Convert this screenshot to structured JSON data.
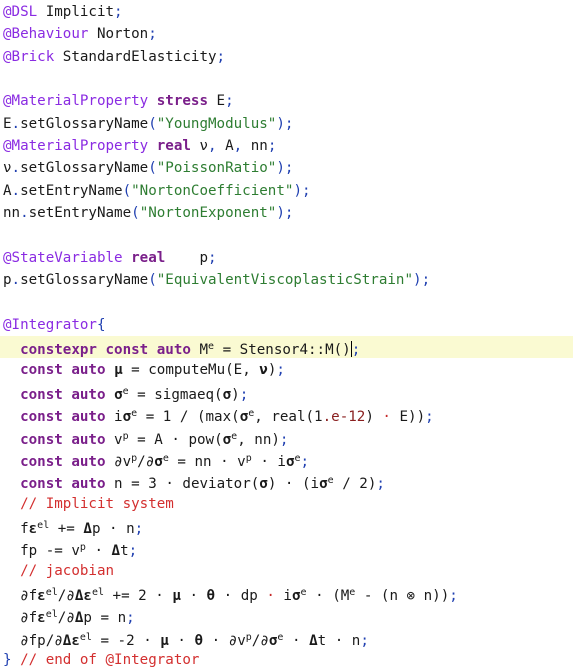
{
  "editor": {
    "highlight_color": "#fafad2",
    "current_line": 15,
    "lines": [
      [
        [
          "t-preproc",
          "@DSL"
        ],
        [
          "t-id",
          " Implicit"
        ],
        [
          "t-blue",
          ";"
        ]
      ],
      [
        [
          "t-preproc",
          "@Behaviour"
        ],
        [
          "t-id",
          " Norton"
        ],
        [
          "t-blue",
          ";"
        ]
      ],
      [
        [
          "t-preproc",
          "@Brick"
        ],
        [
          "t-id",
          " StandardElasticity"
        ],
        [
          "t-blue",
          ";"
        ]
      ],
      [],
      [
        [
          "t-preproc",
          "@MaterialProperty "
        ],
        [
          "t-kw",
          "stress"
        ],
        [
          "t-id",
          " E"
        ],
        [
          "t-blue",
          ";"
        ]
      ],
      [
        [
          "t-id",
          "E"
        ],
        [
          "t-blue",
          "."
        ],
        [
          "t-id",
          "setGlossaryName"
        ],
        [
          "t-blue",
          "("
        ],
        [
          "t-str",
          "\"YoungModulus\""
        ],
        [
          "t-blue",
          ")"
        ],
        [
          "t-blue",
          ";"
        ]
      ],
      [
        [
          "t-preproc",
          "@MaterialProperty "
        ],
        [
          "t-kw",
          "real"
        ],
        [
          "t-id",
          " ν"
        ],
        [
          "t-blue",
          ","
        ],
        [
          "t-id",
          " A"
        ],
        [
          "t-blue",
          ","
        ],
        [
          "t-id",
          " nn"
        ],
        [
          "t-blue",
          ";"
        ]
      ],
      [
        [
          "t-id",
          "ν"
        ],
        [
          "t-blue",
          "."
        ],
        [
          "t-id",
          "setGlossaryName"
        ],
        [
          "t-blue",
          "("
        ],
        [
          "t-str",
          "\"PoissonRatio\""
        ],
        [
          "t-blue",
          ")"
        ],
        [
          "t-blue",
          ";"
        ]
      ],
      [
        [
          "t-id",
          "A"
        ],
        [
          "t-blue",
          "."
        ],
        [
          "t-id",
          "setEntryName"
        ],
        [
          "t-blue",
          "("
        ],
        [
          "t-str",
          "\"NortonCoefficient\""
        ],
        [
          "t-blue",
          ")"
        ],
        [
          "t-blue",
          ";"
        ]
      ],
      [
        [
          "t-id",
          "nn"
        ],
        [
          "t-blue",
          "."
        ],
        [
          "t-id",
          "setEntryName"
        ],
        [
          "t-blue",
          "("
        ],
        [
          "t-str",
          "\"NortonExponent\""
        ],
        [
          "t-blue",
          ")"
        ],
        [
          "t-blue",
          ";"
        ]
      ],
      [],
      [
        [
          "t-preproc",
          "@StateVariable "
        ],
        [
          "t-kw",
          "real"
        ],
        [
          "t-id",
          "    p"
        ],
        [
          "t-blue",
          ";"
        ]
      ],
      [
        [
          "t-id",
          "p"
        ],
        [
          "t-blue",
          "."
        ],
        [
          "t-id",
          "setGlossaryName"
        ],
        [
          "t-blue",
          "("
        ],
        [
          "t-str",
          "\"EquivalentViscoplasticStrain\""
        ],
        [
          "t-blue",
          ")"
        ],
        [
          "t-blue",
          ";"
        ]
      ],
      [],
      [
        [
          "t-preproc",
          "@Integrator"
        ],
        [
          "t-blue",
          "{"
        ]
      ],
      [
        [
          "t-id",
          "  "
        ],
        [
          "t-kw",
          "constexpr const auto"
        ],
        [
          "t-id",
          " M"
        ],
        [
          "t-sup",
          "e"
        ],
        [
          "t-id",
          " = Stensor4::M()"
        ],
        [
          "caret",
          ""
        ],
        [
          "t-blue",
          ";"
        ]
      ],
      [
        [
          "t-id",
          "  "
        ],
        [
          "t-kw",
          "const auto"
        ],
        [
          "t-id",
          " "
        ],
        [
          "t-bold",
          "μ"
        ],
        [
          "t-id",
          " = computeMu(E, "
        ],
        [
          "t-bold",
          "ν"
        ],
        [
          "t-id",
          ")"
        ],
        [
          "t-blue",
          ";"
        ]
      ],
      [
        [
          "t-id",
          "  "
        ],
        [
          "t-kw",
          "const auto"
        ],
        [
          "t-id",
          " "
        ],
        [
          "t-bold",
          "σ"
        ],
        [
          "t-sup",
          "e"
        ],
        [
          "t-id",
          " = sigmaeq("
        ],
        [
          "t-bold",
          "σ"
        ],
        [
          "t-id",
          ")"
        ],
        [
          "t-blue",
          ";"
        ]
      ],
      [
        [
          "t-id",
          "  "
        ],
        [
          "t-kw",
          "const auto"
        ],
        [
          "t-id",
          " i"
        ],
        [
          "t-bold",
          "σ"
        ],
        [
          "t-sup",
          "e"
        ],
        [
          "t-id",
          " = 1 / (max("
        ],
        [
          "t-bold",
          "σ"
        ],
        [
          "t-sup",
          "e"
        ],
        [
          "t-id",
          ", real(1"
        ],
        [
          "t-num",
          ".e-12"
        ],
        [
          "t-id",
          ") "
        ],
        [
          "t-red",
          "·"
        ],
        [
          "t-id",
          " E))"
        ],
        [
          "t-blue",
          ";"
        ]
      ],
      [
        [
          "t-id",
          "  "
        ],
        [
          "t-kw",
          "const auto"
        ],
        [
          "t-id",
          " v"
        ],
        [
          "t-sup",
          "p"
        ],
        [
          "t-id",
          " = A "
        ],
        [
          "t-op",
          "·"
        ],
        [
          "t-id",
          " pow("
        ],
        [
          "t-bold",
          "σ"
        ],
        [
          "t-sup",
          "e"
        ],
        [
          "t-id",
          ", nn)"
        ],
        [
          "t-blue",
          ";"
        ]
      ],
      [
        [
          "t-id",
          "  "
        ],
        [
          "t-kw",
          "const auto"
        ],
        [
          "t-id",
          " ∂v"
        ],
        [
          "t-sup",
          "p"
        ],
        [
          "t-id",
          "/∂"
        ],
        [
          "t-bold",
          "σ"
        ],
        [
          "t-sup",
          "e"
        ],
        [
          "t-id",
          " = nn "
        ],
        [
          "t-op",
          "·"
        ],
        [
          "t-id",
          " v"
        ],
        [
          "t-sup",
          "p"
        ],
        [
          "t-id",
          " "
        ],
        [
          "t-op",
          "·"
        ],
        [
          "t-id",
          " i"
        ],
        [
          "t-bold",
          "σ"
        ],
        [
          "t-sup",
          "e"
        ],
        [
          "t-blue",
          ";"
        ]
      ],
      [
        [
          "t-id",
          "  "
        ],
        [
          "t-kw",
          "const auto"
        ],
        [
          "t-id",
          " n = 3 "
        ],
        [
          "t-op",
          "·"
        ],
        [
          "t-id",
          " deviator("
        ],
        [
          "t-bold",
          "σ"
        ],
        [
          "t-id",
          ") "
        ],
        [
          "t-op",
          "·"
        ],
        [
          "t-id",
          " (i"
        ],
        [
          "t-bold",
          "σ"
        ],
        [
          "t-sup",
          "e"
        ],
        [
          "t-id",
          " / 2)"
        ],
        [
          "t-blue",
          ";"
        ]
      ],
      [
        [
          "t-id",
          "  "
        ],
        [
          "t-comment",
          "// Implicit system"
        ]
      ],
      [
        [
          "t-id",
          "  f"
        ],
        [
          "t-bold",
          "ε"
        ],
        [
          "t-sup",
          "el"
        ],
        [
          "t-id",
          " += "
        ],
        [
          "t-bold",
          "Δ"
        ],
        [
          "t-id",
          "p "
        ],
        [
          "t-op",
          "·"
        ],
        [
          "t-id",
          " n"
        ],
        [
          "t-blue",
          ";"
        ]
      ],
      [
        [
          "t-id",
          "  fp -= v"
        ],
        [
          "t-sup",
          "p"
        ],
        [
          "t-id",
          " "
        ],
        [
          "t-op",
          "·"
        ],
        [
          "t-id",
          " "
        ],
        [
          "t-bold",
          "Δ"
        ],
        [
          "t-id",
          "t"
        ],
        [
          "t-blue",
          ";"
        ]
      ],
      [
        [
          "t-id",
          "  "
        ],
        [
          "t-comment",
          "// jacobian"
        ]
      ],
      [
        [
          "t-id",
          "  ∂f"
        ],
        [
          "t-bold",
          "ε"
        ],
        [
          "t-sup",
          "el"
        ],
        [
          "t-id",
          "/∂"
        ],
        [
          "t-bold",
          "Δε"
        ],
        [
          "t-sup",
          "el"
        ],
        [
          "t-id",
          " += 2 "
        ],
        [
          "t-op",
          "·"
        ],
        [
          "t-id",
          " "
        ],
        [
          "t-bold",
          "μ"
        ],
        [
          "t-id",
          " "
        ],
        [
          "t-op",
          "·"
        ],
        [
          "t-id",
          " "
        ],
        [
          "t-bold",
          "θ"
        ],
        [
          "t-id",
          " "
        ],
        [
          "t-op",
          "·"
        ],
        [
          "t-id",
          " dp "
        ],
        [
          "t-red",
          "·"
        ],
        [
          "t-id",
          " i"
        ],
        [
          "t-bold",
          "σ"
        ],
        [
          "t-sup",
          "e"
        ],
        [
          "t-id",
          " "
        ],
        [
          "t-op",
          "·"
        ],
        [
          "t-id",
          " (M"
        ],
        [
          "t-sup",
          "e"
        ],
        [
          "t-id",
          " - (n ⊗ n))"
        ],
        [
          "t-blue",
          ";"
        ]
      ],
      [
        [
          "t-id",
          "  ∂f"
        ],
        [
          "t-bold",
          "ε"
        ],
        [
          "t-sup",
          "el"
        ],
        [
          "t-id",
          "/∂"
        ],
        [
          "t-bold",
          "Δ"
        ],
        [
          "t-id",
          "p = n"
        ],
        [
          "t-blue",
          ";"
        ]
      ],
      [
        [
          "t-id",
          "  ∂fp/∂"
        ],
        [
          "t-bold",
          "Δε"
        ],
        [
          "t-sup",
          "el"
        ],
        [
          "t-id",
          " = -2 "
        ],
        [
          "t-op",
          "·"
        ],
        [
          "t-id",
          " "
        ],
        [
          "t-bold",
          "μ"
        ],
        [
          "t-id",
          " "
        ],
        [
          "t-op",
          "·"
        ],
        [
          "t-id",
          " "
        ],
        [
          "t-bold",
          "θ"
        ],
        [
          "t-id",
          " "
        ],
        [
          "t-op",
          "·"
        ],
        [
          "t-id",
          " ∂v"
        ],
        [
          "t-sup",
          "p"
        ],
        [
          "t-id",
          "/∂"
        ],
        [
          "t-bold",
          "σ"
        ],
        [
          "t-sup",
          "e"
        ],
        [
          "t-id",
          " "
        ],
        [
          "t-op",
          "·"
        ],
        [
          "t-id",
          " "
        ],
        [
          "t-bold",
          "Δ"
        ],
        [
          "t-id",
          "t "
        ],
        [
          "t-op",
          "·"
        ],
        [
          "t-id",
          " n"
        ],
        [
          "t-blue",
          ";"
        ]
      ],
      [
        [
          "t-blue",
          "}"
        ],
        [
          "t-comment",
          " // end of @Integrator"
        ]
      ]
    ]
  }
}
